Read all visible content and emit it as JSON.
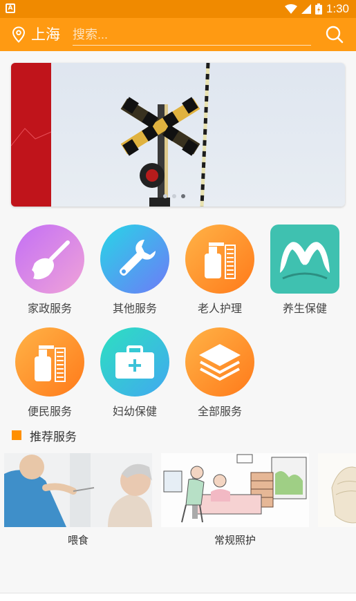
{
  "status": {
    "time": "1:30",
    "app_badge": "A"
  },
  "header": {
    "city": "上海",
    "search_placeholder": "搜索..."
  },
  "banner": {
    "slides": 3,
    "active_slide": 3
  },
  "services": [
    {
      "label": "家政服务",
      "icon": "broom-icon",
      "color_from": "#c36ff5",
      "color_to": "#f0a3d8"
    },
    {
      "label": "其他服务",
      "icon": "wrench-icon",
      "color_from": "#27d6e6",
      "color_to": "#6e7af7"
    },
    {
      "label": "老人护理",
      "icon": "care-bottle-icon",
      "color_from": "#ffb347",
      "color_to": "#ff7a1a"
    },
    {
      "label": "养生保健",
      "icon": "health-mountain-icon",
      "color_from": "#3fc1b0",
      "color_to": "#3fc1b0"
    },
    {
      "label": "便民服务",
      "icon": "convenience-bottle-icon",
      "color_from": "#ffb347",
      "color_to": "#ff7a1a"
    },
    {
      "label": "妇幼保健",
      "icon": "medical-kit-icon",
      "color_from": "#2de0c0",
      "color_to": "#41a8f0"
    },
    {
      "label": "全部服务",
      "icon": "layers-icon",
      "color_from": "#ffb347",
      "color_to": "#ff7a1a"
    }
  ],
  "recommend": {
    "title": "推荐服务",
    "items": [
      {
        "caption": "喂食"
      },
      {
        "caption": "常规照护"
      },
      {
        "caption": ""
      }
    ]
  },
  "colors": {
    "primary": "#ff9a12",
    "status_bar": "#f08a00",
    "accent": "#ff8f00"
  }
}
